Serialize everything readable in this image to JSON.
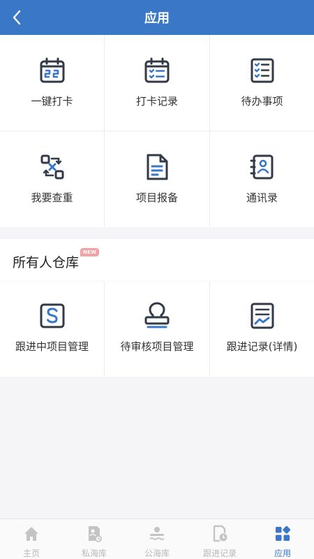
{
  "header": {
    "title": "应用",
    "back_icon": "chevron-left-icon"
  },
  "apps": [
    {
      "label": "一键打卡",
      "icon": "calendar-22-icon"
    },
    {
      "label": "打卡记录",
      "icon": "calendar-checklist-icon"
    },
    {
      "label": "待办事项",
      "icon": "checklist-icon"
    },
    {
      "label": "我要查重",
      "icon": "swap-check-icon"
    },
    {
      "label": "项目报备",
      "icon": "document-icon"
    },
    {
      "label": "通讯录",
      "icon": "contact-book-icon"
    }
  ],
  "warehouse": {
    "title": "所有人仓库",
    "badge": "NEW",
    "items": [
      {
        "label": "跟进中项目管理",
        "icon": "s-square-icon"
      },
      {
        "label": "待审核项目管理",
        "icon": "stamp-icon"
      },
      {
        "label": "跟进记录(详情)",
        "icon": "trend-document-icon"
      }
    ]
  },
  "tabs": [
    {
      "label": "主页",
      "icon": "home-icon"
    },
    {
      "label": "私海库",
      "icon": "private-sea-icon"
    },
    {
      "label": "公海库",
      "icon": "public-sea-icon"
    },
    {
      "label": "跟进记录",
      "icon": "follow-record-icon"
    },
    {
      "label": "应用",
      "icon": "apps-icon",
      "active": true
    }
  ],
  "colors": {
    "primary": "#3a78c7",
    "icon_dark": "#333a47",
    "icon_accent": "#3a78c7",
    "tab_inactive": "#b8b8b8",
    "badge": "#f2a3a3"
  }
}
